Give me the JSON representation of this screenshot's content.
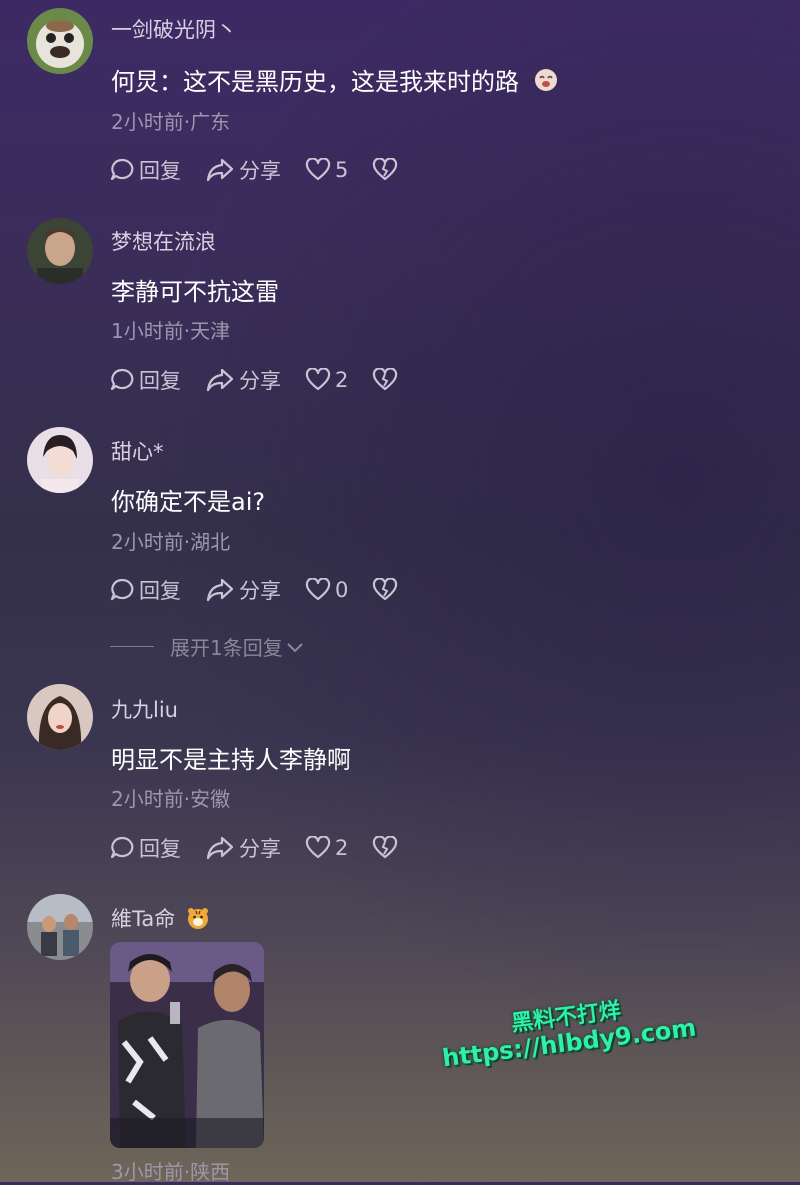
{
  "comments": [
    {
      "username": "一剑破光阴丶",
      "text": "何炅：这不是黑历史，这是我来时的路",
      "meta": "2小时前·广东",
      "reply_label": "回复",
      "share_label": "分享",
      "likes": "5"
    },
    {
      "username": "梦想在流浪",
      "text": "李静可不抗这雷",
      "meta": "1小时前·天津",
      "reply_label": "回复",
      "share_label": "分享",
      "likes": "2"
    },
    {
      "username": "甜心*",
      "text": "你确定不是ai?",
      "meta": "2小时前·湖北",
      "reply_label": "回复",
      "share_label": "分享",
      "likes": "0"
    },
    {
      "username": "九九liu",
      "text": "明显不是主持人李静啊",
      "meta": "2小时前·安徽",
      "reply_label": "回复",
      "share_label": "分享",
      "likes": "2"
    },
    {
      "username": "維Ta命",
      "meta": "3小时前·陕西"
    }
  ],
  "expand_replies": "展开1条回复",
  "watermark": {
    "line1": "黑料不打烊",
    "line2": "https://hlbdy9.com"
  },
  "colors": {
    "watermark": "#2ef0a6",
    "meta": "#9d96ad",
    "text": "#ffffff"
  }
}
